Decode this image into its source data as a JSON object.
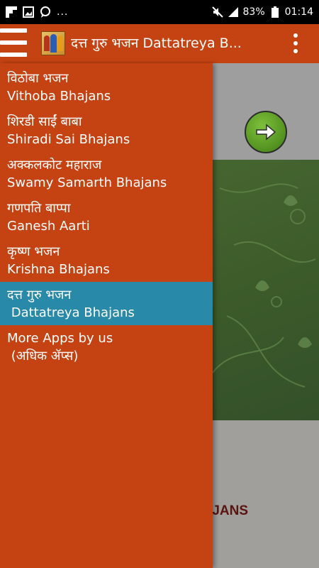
{
  "status_bar": {
    "battery_percent": "83%",
    "time": "01:14",
    "more_notifications": "..."
  },
  "app_bar": {
    "title": "दत्त गुरु भजन   Dattatreya B..."
  },
  "drawer": {
    "items": [
      {
        "line1": "विठोबा भजन",
        "line2": "Vithoba Bhajans"
      },
      {
        "line1": "शिरडी साईं बाबा",
        "line2": "Shiradi Sai Bhajans"
      },
      {
        "line1": "अक्कलकोट महाराज",
        "line2": "Swamy Samarth Bhajans"
      },
      {
        "line1": "गणपति बाप्पा",
        "line2": "Ganesh Aarti"
      },
      {
        "line1": "कृष्ण भजन",
        "line2": "Krishna Bhajans"
      },
      {
        "line1": "दत्त गुरु भजन",
        "line2": " Dattatreya Bhajans"
      },
      {
        "line1": "More Apps by us",
        "line2": " (अधिक ॲप्स)"
      }
    ]
  },
  "background": {
    "partial_text": "JANS"
  },
  "colors": {
    "primary": "#c54312",
    "active_item": "#2989a8",
    "status_bar": "#000000"
  }
}
